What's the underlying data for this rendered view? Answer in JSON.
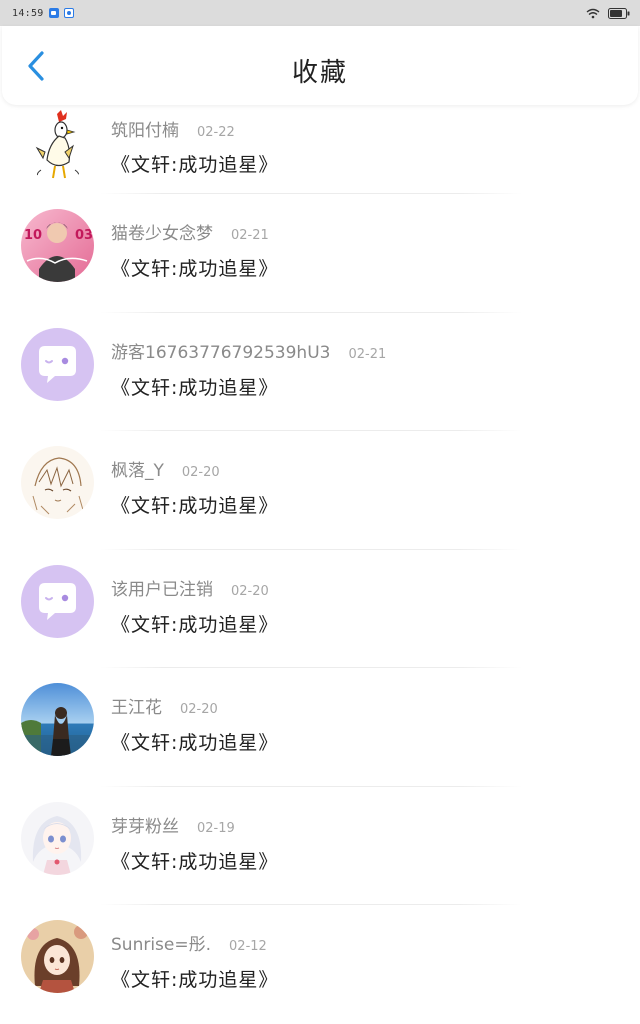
{
  "status_bar": {
    "time": "14:59"
  },
  "header": {
    "title": "收藏"
  },
  "items": [
    {
      "username": "筑阳付楠",
      "date": "02-22",
      "title": "《文轩:成功追星》",
      "avatar": "rooster-avatar"
    },
    {
      "username": "猫卷少女念梦",
      "date": "02-21",
      "title": "《文轩:成功追星》",
      "avatar": "photo-avatar"
    },
    {
      "username": "游客16763776792539hU3",
      "date": "02-21",
      "title": "《文轩:成功追星》",
      "avatar": "default-chat-avatar"
    },
    {
      "username": "枫落_Y",
      "date": "02-20",
      "title": "《文轩:成功追星》",
      "avatar": "sketch-avatar"
    },
    {
      "username": "该用户已注销",
      "date": "02-20",
      "title": "《文轩:成功追星》",
      "avatar": "default-chat-avatar"
    },
    {
      "username": "王江花",
      "date": "02-20",
      "title": "《文轩:成功追星》",
      "avatar": "beach-photo-avatar"
    },
    {
      "username": "芽芽粉丝",
      "date": "02-19",
      "title": "《文轩:成功追星》",
      "avatar": "anime-girl-avatar"
    },
    {
      "username": "Sunrise=彤.",
      "date": "02-12",
      "title": "《文轩:成功追星》",
      "avatar": "anime-portrait-avatar"
    }
  ],
  "colors": {
    "accent": "#2a8fe0",
    "default_avatar": "#d6c3f2",
    "status_bar_bg": "#dcdcdc"
  }
}
